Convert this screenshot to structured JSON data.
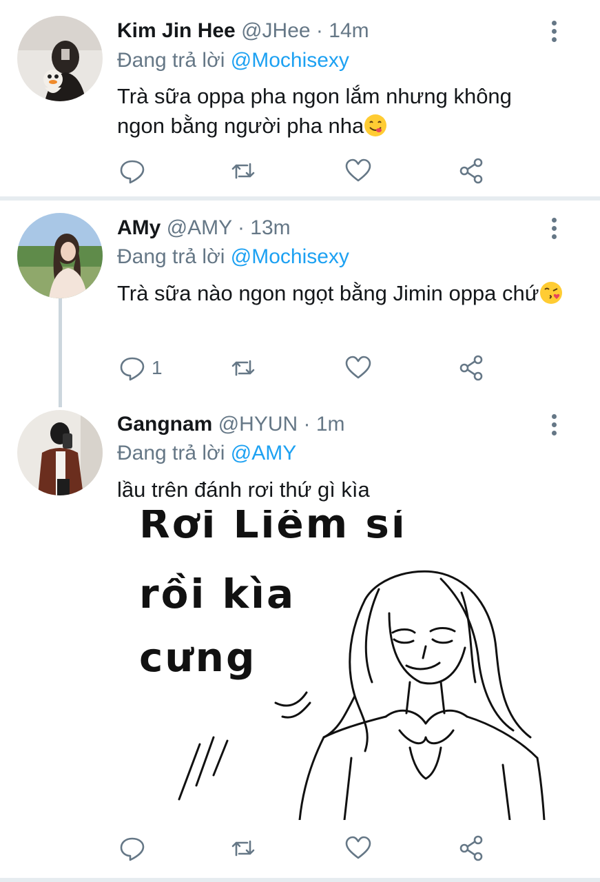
{
  "tweets": [
    {
      "name": "Kim Jin Hee",
      "handle": "@JHee",
      "dot": "·",
      "time": "14m",
      "reply_prefix": "Đang trả lời",
      "reply_to": "@Mochisexy",
      "text": "Trà sữa oppa pha ngon lắm nhưng không ngon bằng người pha nha",
      "emoji": "yum-face-emoji",
      "reply_count": ""
    },
    {
      "name": "AMy",
      "handle": "@AMY",
      "dot": "·",
      "time": "13m",
      "reply_prefix": "Đang trả lời",
      "reply_to": "@Mochisexy",
      "text": "Trà sữa nào ngon ngọt bằng Jimin oppa chứ",
      "emoji": "kissing-face-emoji",
      "reply_count": "1"
    },
    {
      "name": "Gangnam",
      "handle": "@HYUN",
      "dot": "·",
      "time": "1m",
      "reply_prefix": "Đang trả lời",
      "reply_to": "@AMY",
      "text": "lầu trên đánh rơi thứ gì kìa",
      "reply_count": ""
    }
  ],
  "meme": {
    "line1": "Rơi Liêm sỉ",
    "line2": "rồi kìa",
    "line3": "cưng"
  },
  "icons": {
    "reply": "reply-icon",
    "retweet": "retweet-icon",
    "like": "like-icon",
    "share": "share-icon",
    "more": "more-vertical-icon"
  },
  "colors": {
    "mention": "#1da1f2",
    "secondary": "#657786",
    "divider": "#e6ecf0"
  }
}
